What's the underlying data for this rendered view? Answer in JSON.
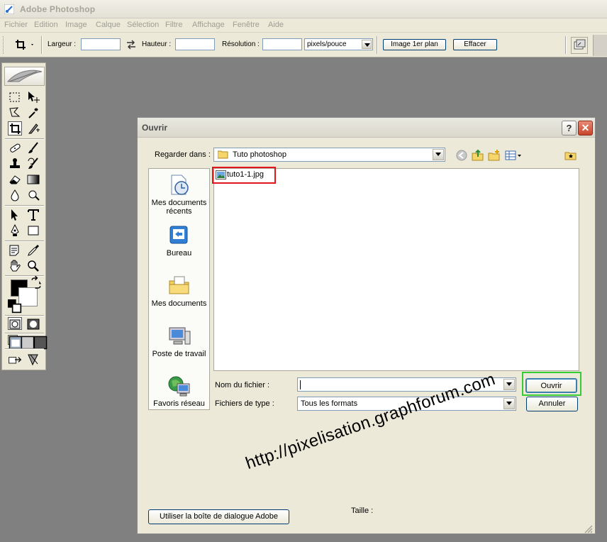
{
  "app": {
    "title": "Adobe Photoshop"
  },
  "menu": [
    "Fichier",
    "Edition",
    "Image",
    "Calque",
    "Sélection",
    "Filtre",
    "Affichage",
    "Fenêtre",
    "Aide"
  ],
  "options": {
    "width_label": "Largeur :",
    "width_value": "",
    "height_label": "Hauteur :",
    "height_value": "",
    "resolution_label": "Résolution :",
    "resolution_value": "",
    "units_selected": "pixels/pouce",
    "front_image_button": "Image 1er plan",
    "clear_button": "Effacer"
  },
  "colors": {
    "foreground": "#000000",
    "background": "#ffffff"
  },
  "dialog": {
    "title": "Ouvrir",
    "look_in_label": "Regarder dans :",
    "look_in_value": "Tuto photoshop",
    "places": [
      {
        "label": "Mes documents récents",
        "icon": "recent-documents-icon"
      },
      {
        "label": "Bureau",
        "icon": "desktop-icon"
      },
      {
        "label": "Mes documents",
        "icon": "my-documents-icon"
      },
      {
        "label": "Poste de travail",
        "icon": "my-computer-icon"
      },
      {
        "label": "Favoris réseau",
        "icon": "network-places-icon"
      }
    ],
    "files": [
      {
        "name": "tuto1-1.jpg",
        "icon": "image-file-icon"
      }
    ],
    "filename_label": "Nom du fichier :",
    "filename_value": "",
    "filetype_label": "Fichiers de type :",
    "filetype_value": "Tous les formats",
    "open_button": "Ouvrir",
    "cancel_button": "Annuler",
    "adobe_dialog_button": "Utiliser la boîte de dialogue Adobe",
    "size_label": "Taille :"
  },
  "watermark": "http://pixelisation.graphforum.com"
}
